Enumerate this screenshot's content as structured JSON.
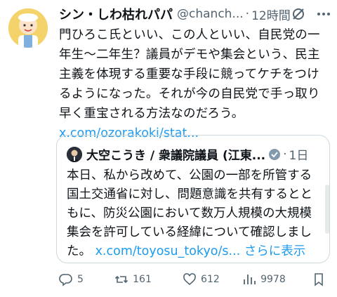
{
  "tweet": {
    "display_name": "シン・しわ枯れパパ",
    "handle": "@chanch...",
    "separator": "·",
    "time": "12時間",
    "lines": [
      "門ひろこ氏といい、この人といい、自民党の一",
      "年生〜二年生？議員がデモや集会という、民主",
      "主義を体現する重要な手段に競ってケチをつけ",
      "るようになった。それが今の自民党で手っ取り",
      "早く重宝される方法なのだろう。"
    ],
    "link": "x.com/ozorakoki/stat..."
  },
  "quote": {
    "name": "大空こうき / 衆議院議員 (江東...",
    "separator": "·",
    "time": "1日",
    "lines": [
      "本日、私から改めて、公園の一部を所管する",
      "国土交通省に対し、問題意識を共有するとと",
      "もに、防災公園において数万人規模の大規模",
      "集会を許可している経緯について確認しまし"
    ],
    "last_line_prefix": "た。",
    "link": "x.com/toyosu_tokyo/s...",
    "show_more": "さらに表示"
  },
  "actions": {
    "replies": "5",
    "retweets": "161",
    "likes": "612",
    "views": "9978"
  },
  "colors": {
    "link": "#1d9bf0",
    "secondary": "#536471",
    "border": "#cfd9de"
  },
  "icons": [
    "grok-icon",
    "more-icon",
    "verified-badge-icon",
    "reply-icon",
    "retweet-icon",
    "like-icon",
    "views-icon",
    "bookmark-icon"
  ]
}
